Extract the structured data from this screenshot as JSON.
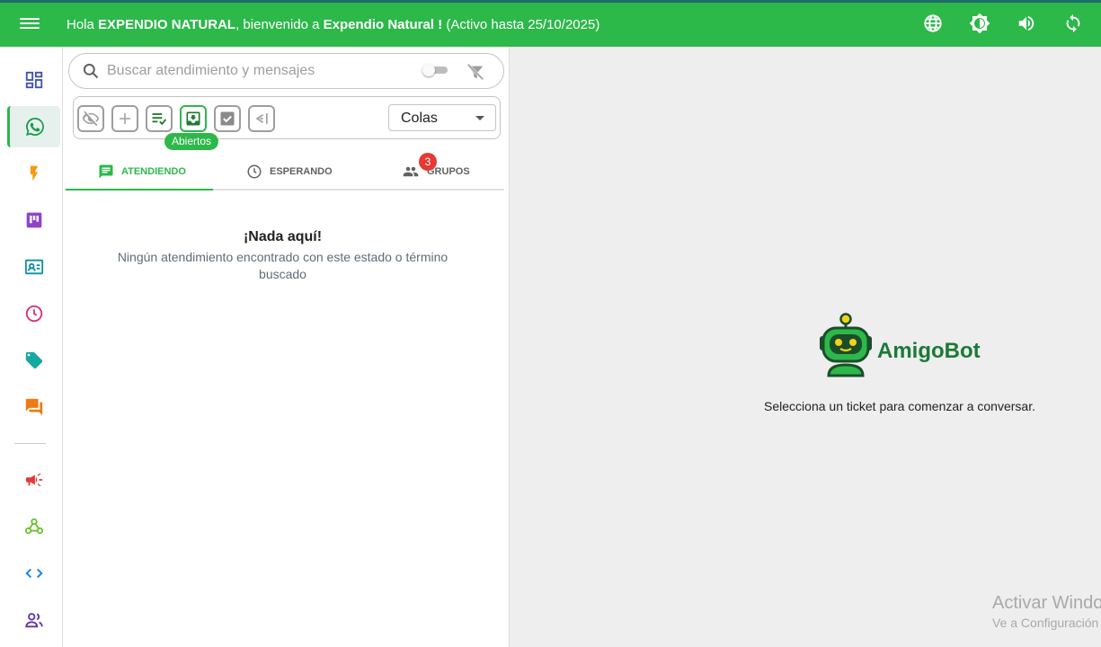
{
  "header": {
    "greeting_prefix": "Hola ",
    "company": "EXPENDIO NATURAL",
    "greeting_middle": ", bienvenido a ",
    "app_name": "Expendio Natural !",
    "active_until": " (Activo hasta 25/10/2025)",
    "icons": [
      "globe-icon",
      "brightness-icon",
      "volume-icon",
      "refresh-icon"
    ],
    "bar_color": "#2db84a"
  },
  "sidebar": {
    "items": [
      "dashboard-icon",
      "whatsapp-icon",
      "lightning-icon",
      "kanban-icon",
      "contacts-icon",
      "schedule-icon",
      "tag-icon",
      "chat-icon",
      "campaign-icon",
      "webhook-icon",
      "code-icon",
      "users-icon"
    ],
    "active": "whatsapp-icon"
  },
  "search": {
    "placeholder": "Buscar atendimiento y mensajes",
    "value": ""
  },
  "toolbar": {
    "buttons": [
      "hide-icon",
      "add-icon",
      "checklist-icon",
      "inbox-icon",
      "check-box-icon",
      "send-icon"
    ],
    "active_button": "inbox-icon",
    "tooltip": "Abiertos",
    "queue_select": "Colas"
  },
  "tabs": {
    "attending": "ATENDIENDO",
    "waiting": "ESPERANDO",
    "groups": "GRUPOS",
    "groups_badge": "3",
    "active": "attending"
  },
  "empty_state": {
    "title": "¡Nada aquí!",
    "message": "Ningún atendimiento encontrado con este estado o término buscado"
  },
  "main": {
    "brand": "AmigoBot",
    "message": "Selecciona un ticket para comenzar a conversar.",
    "watermark_title": "Activar Windo",
    "watermark_sub": "Ve a Configuración"
  }
}
